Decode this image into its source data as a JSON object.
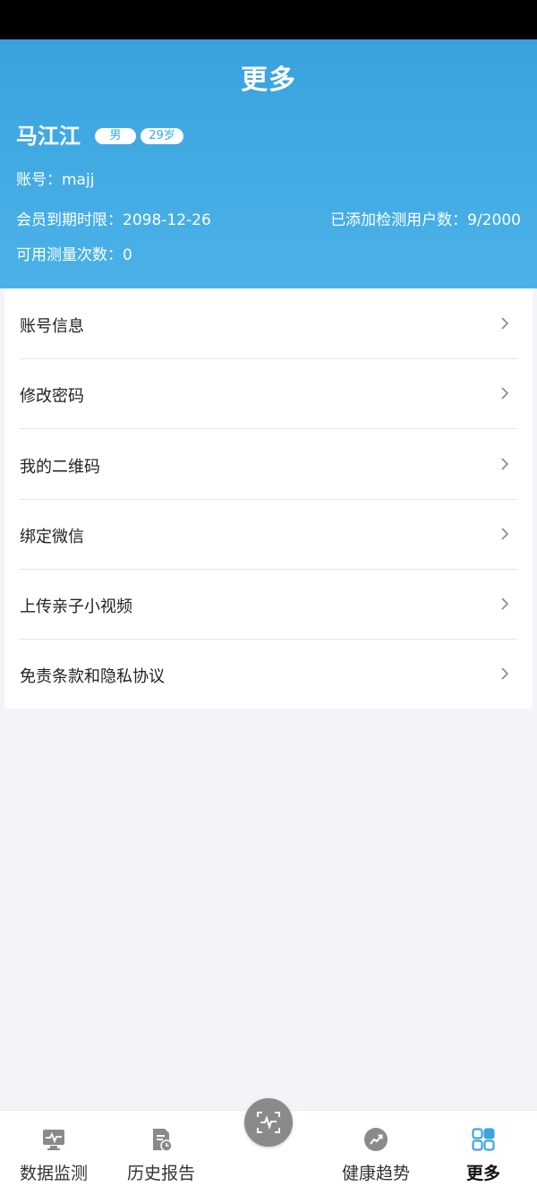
{
  "header": {
    "title": "更多"
  },
  "user": {
    "name": "马江江",
    "gender": "男",
    "age": "29岁",
    "account": "账号：majj",
    "membership_expire": "会员到期时限：2098-12-26",
    "added_users": "已添加检测用户数：9/2000",
    "available_measurements": "可用测量次数：0"
  },
  "menu": {
    "items": [
      {
        "label": "账号信息"
      },
      {
        "label": "修改密码"
      },
      {
        "label": "我的二维码"
      },
      {
        "label": "绑定微信"
      },
      {
        "label": "上传亲子小视频"
      },
      {
        "label": "免责条款和隐私协议"
      }
    ]
  },
  "bottom_nav": {
    "items": [
      {
        "label": "数据监测",
        "icon": "monitor-icon"
      },
      {
        "label": "历史报告",
        "icon": "report-icon"
      },
      {
        "label": "健康趋势",
        "icon": "trend-icon"
      },
      {
        "label": "更多",
        "icon": "grid-icon",
        "active": true
      }
    ],
    "center_icon": "scan-pulse-icon"
  },
  "colors": {
    "header_blue": "#3aa5e0",
    "active_icon": "#3aa5e0",
    "inactive_icon": "#8a8a8a"
  }
}
